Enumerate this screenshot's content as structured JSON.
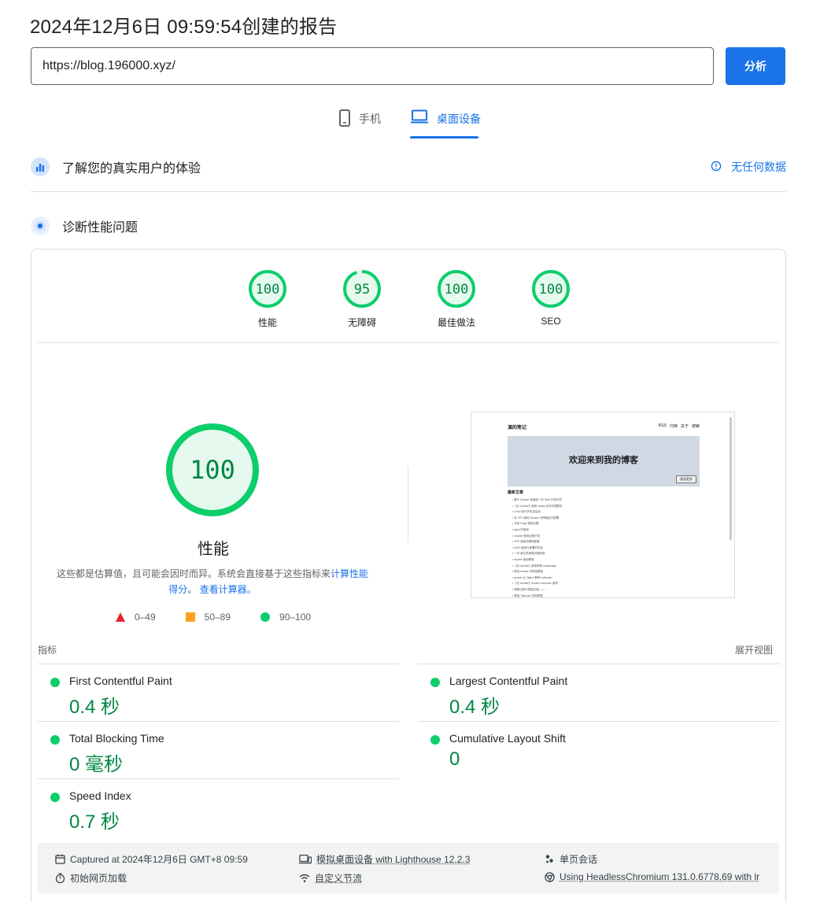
{
  "report": {
    "title": "2024年12月6日 09:59:54创建的报告"
  },
  "search": {
    "url": "https://blog.196000.xyz/",
    "analyze_label": "分析"
  },
  "tabs": [
    {
      "label": "手机",
      "icon": "phone-icon",
      "active": false
    },
    {
      "label": "桌面设备",
      "icon": "laptop-icon",
      "active": true
    }
  ],
  "crux": {
    "title": "了解您的真实用户的体验",
    "no_data_label": "无任何数据"
  },
  "diagnose": {
    "title": "诊断性能问题"
  },
  "gauges": [
    {
      "score": "100",
      "label": "性能",
      "value": 100
    },
    {
      "score": "95",
      "label": "无障碍",
      "value": 95
    },
    {
      "score": "100",
      "label": "最佳做法",
      "value": 100
    },
    {
      "score": "100",
      "label": "SEO",
      "value": 100
    }
  ],
  "performance": {
    "score": "100",
    "label": "性能",
    "desc_prefix": "这些都是估算值，且可能会因时而异。系统会直接基于这些指标来",
    "desc_link1": "计算性能得分",
    "desc_mid": "。",
    "desc_link2": "查看计算器。"
  },
  "legend": [
    {
      "range": "0–49",
      "shape": "triangle",
      "color": "#e8212b"
    },
    {
      "range": "50–89",
      "shape": "square",
      "color": "#ffa11f"
    },
    {
      "range": "90–100",
      "shape": "circle",
      "color": "#0cce6b"
    }
  ],
  "screenshot": {
    "site_title": "演的笔记",
    "nav": [
      "RSS",
      "归档",
      "关于",
      "搜索"
    ],
    "hero_text": "欢迎来到我的博客",
    "hero_button": "阅读更多",
    "list_heading": "最新文章",
    "items": [
      "基于 Docker 快速搭一份 Web 开发环境",
      "【长 docker】使用 caddy 反向代理服务",
      "Linux 执行开机自启动",
      "在 VPS 使用 Docker 对博客进行部署",
      "关闭 Hugo 搜索问题",
      "layui 的使用",
      "vscode 使用远程开发",
      "VPS 面板的基础配置",
      "2024 使用与部署的项目",
      "一次 源主机网络问题排查",
      "docker 使用教程",
      "【长 docker】使用简单 easyimage",
      "再谈 docker 内网络模型",
      "docker 让 Nginx 联网 kubeadm",
      "【长 docker】docker compose 使用",
      "博客迁移与搭建过程——",
      "使用 Tailscale 内网穿透"
    ]
  },
  "metrics": {
    "header": "指标",
    "expand_label": "展开视图",
    "items": [
      {
        "name": "First Contentful Paint",
        "value": "0.4 秒"
      },
      {
        "name": "Largest Contentful Paint",
        "value": "0.4 秒"
      },
      {
        "name": "Total Blocking Time",
        "value": "0 毫秒"
      },
      {
        "name": "Cumulative Layout Shift",
        "value": "0"
      },
      {
        "name": "Speed Index",
        "value": "0.7 秒"
      }
    ]
  },
  "runtime": {
    "captured": "Captured at 2024年12月6日 GMT+8 09:59",
    "device": "模拟桌面设备 with Lighthouse 12.2.3",
    "session": "单页会话",
    "load": "初始网页加载",
    "throttling": "自定义节流",
    "browser": "Using HeadlessChromium 131.0.6778.69 with lr"
  },
  "colors": {
    "accent": "#1a73e8",
    "pass": "#0cce6b",
    "pass_text": "#018642",
    "average": "#ffa11f",
    "fail": "#e8212b"
  }
}
